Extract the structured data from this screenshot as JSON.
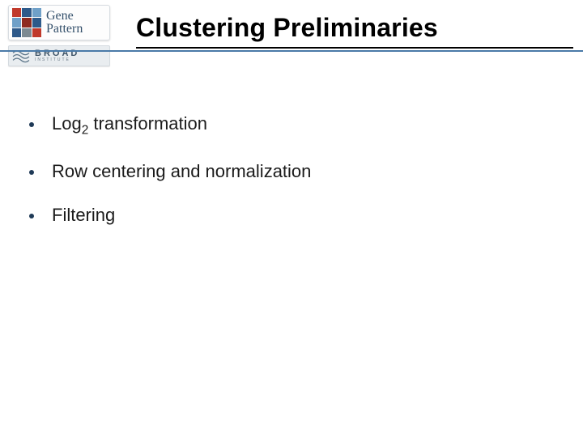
{
  "logo": {
    "gene": "Gene",
    "pattern": "Pattern",
    "broad_line1": "BROAD",
    "broad_line2": "INSTITUTE"
  },
  "title": "Clustering Preliminaries",
  "bullets": [
    {
      "prefix": "Log",
      "sub": "2",
      "suffix": " transformation"
    },
    {
      "text": "Row centering and normalization"
    },
    {
      "text": "Filtering"
    }
  ]
}
